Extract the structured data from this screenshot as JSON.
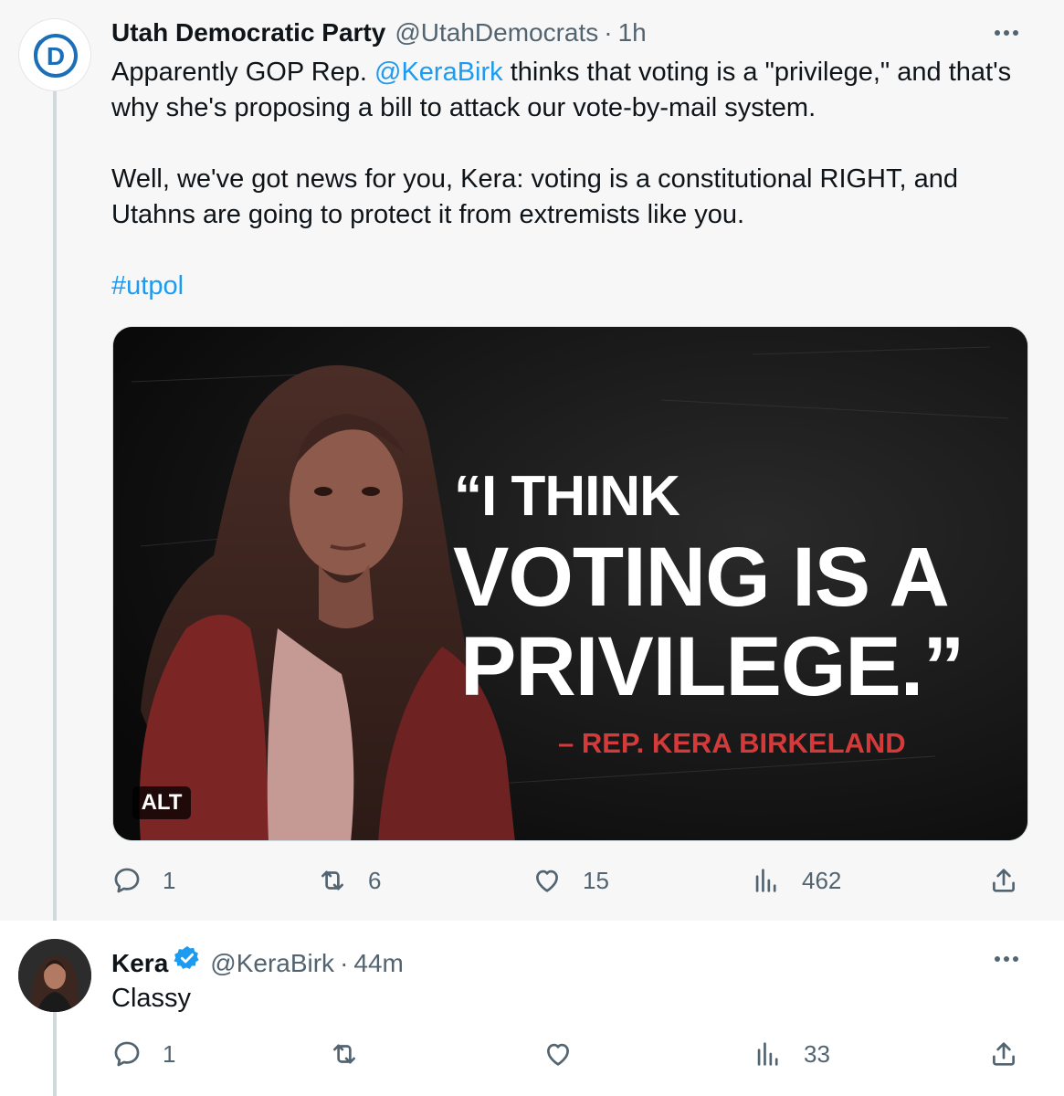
{
  "tweet1": {
    "display_name": "Utah Democratic Party",
    "handle": "@UtahDemocrats",
    "separator": "·",
    "time": "1h",
    "text_line1_before": "Apparently GOP Rep. ",
    "text_mention": "@KeraBirk",
    "text_line1_after": " thinks that voting is a \"privilege,\" and that's why she's proposing a bill to attack our vote-by-mail system.",
    "text_para2": "Well, we've got news for you, Kera: voting is a constitutional RIGHT, and Utahns are going to protect it from extremists like you.",
    "hashtag": "#utpol",
    "media": {
      "quote_line1": "“I THINK",
      "quote_line2": "VOTING IS A",
      "quote_line3": "PRIVILEGE.”",
      "attribution": "– REP. KERA BIRKELAND",
      "alt_badge": "ALT"
    },
    "stats": {
      "replies": "1",
      "retweets": "6",
      "likes": "15",
      "views": "462"
    }
  },
  "tweet2": {
    "display_name": "Kera",
    "handle": "@KeraBirk",
    "separator": "·",
    "time": "44m",
    "text": "Classy",
    "stats": {
      "replies": "1",
      "views": "33"
    }
  },
  "colors": {
    "link": "#1d9bf0",
    "secondary_text": "#536471",
    "verified": "#1d9bf0",
    "quote_attribution": "#d53a3a"
  },
  "icons": [
    "reply-icon",
    "retweet-icon",
    "like-icon",
    "views-icon",
    "share-icon",
    "more-icon",
    "verified-icon",
    "democrat-logo-icon"
  ]
}
